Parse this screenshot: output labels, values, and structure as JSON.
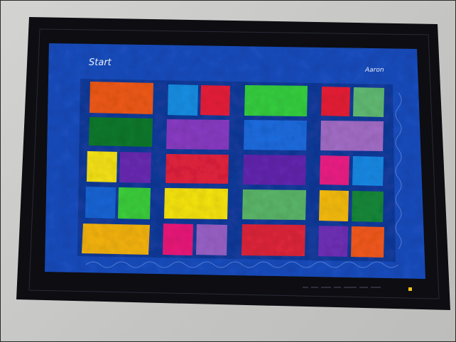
{
  "quilt": {
    "left_label": "Start",
    "right_label": "Aaron",
    "colors": {
      "binding": "#0d0d12",
      "background_blue": "#1b4fc0",
      "sashing_blue": "#1540a8",
      "wall": "#c9c9c7"
    }
  }
}
